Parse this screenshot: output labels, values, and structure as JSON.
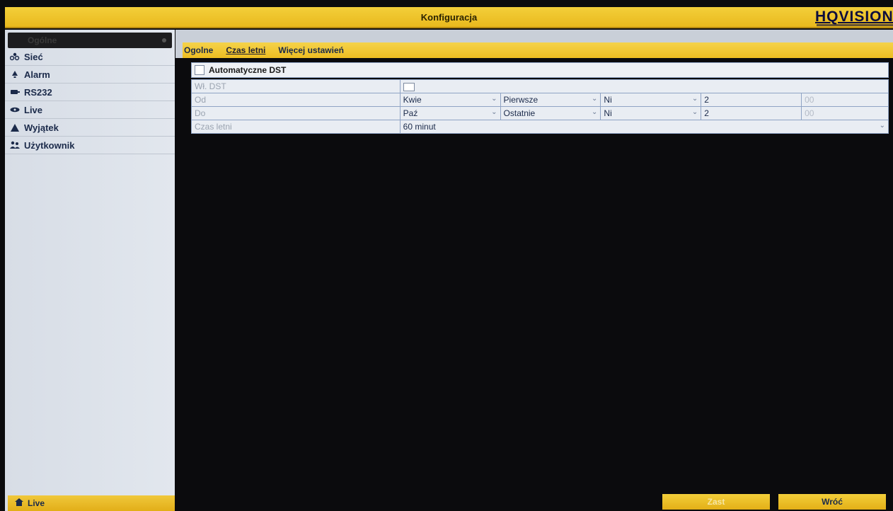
{
  "window": {
    "title": "Konfiguracja",
    "brand": "HQVISION"
  },
  "sidebar": {
    "header": "Ogólne",
    "items": [
      {
        "label": "Sieć",
        "icon": "network-icon"
      },
      {
        "label": "Alarm",
        "icon": "alarm-icon"
      },
      {
        "label": "RS232",
        "icon": "rs232-icon"
      },
      {
        "label": "Live",
        "icon": "eye-icon"
      },
      {
        "label": "Wyjątek",
        "icon": "warning-icon"
      },
      {
        "label": "Użytkownik",
        "icon": "users-icon"
      }
    ],
    "footer": {
      "label": "Live",
      "icon": "home-icon"
    }
  },
  "tabs": [
    {
      "label": "Ogolne"
    },
    {
      "label": "Czas letni",
      "active": true
    },
    {
      "label": "Więcej ustawień"
    }
  ],
  "dst": {
    "auto_label": "Automatyczne DST",
    "enable_label": "Wł. DST",
    "from_label": "Od",
    "to_label": "Do",
    "dst_label": "Czas letni",
    "from": {
      "month": "Kwie",
      "week": "Pierwsze",
      "day": "Ni",
      "hour": "2",
      "minute": "00"
    },
    "to": {
      "month": "Paź",
      "week": "Ostatnie",
      "day": "Ni",
      "hour": "2",
      "minute": "00"
    },
    "bias": "60 minut"
  },
  "buttons": {
    "apply": "Zast",
    "back": "Wróć"
  },
  "colors": {
    "accent": "#EDBD22",
    "background": "#0B0B0D",
    "sidebar": "#DDE2EA",
    "text": "#1B2A4A"
  }
}
